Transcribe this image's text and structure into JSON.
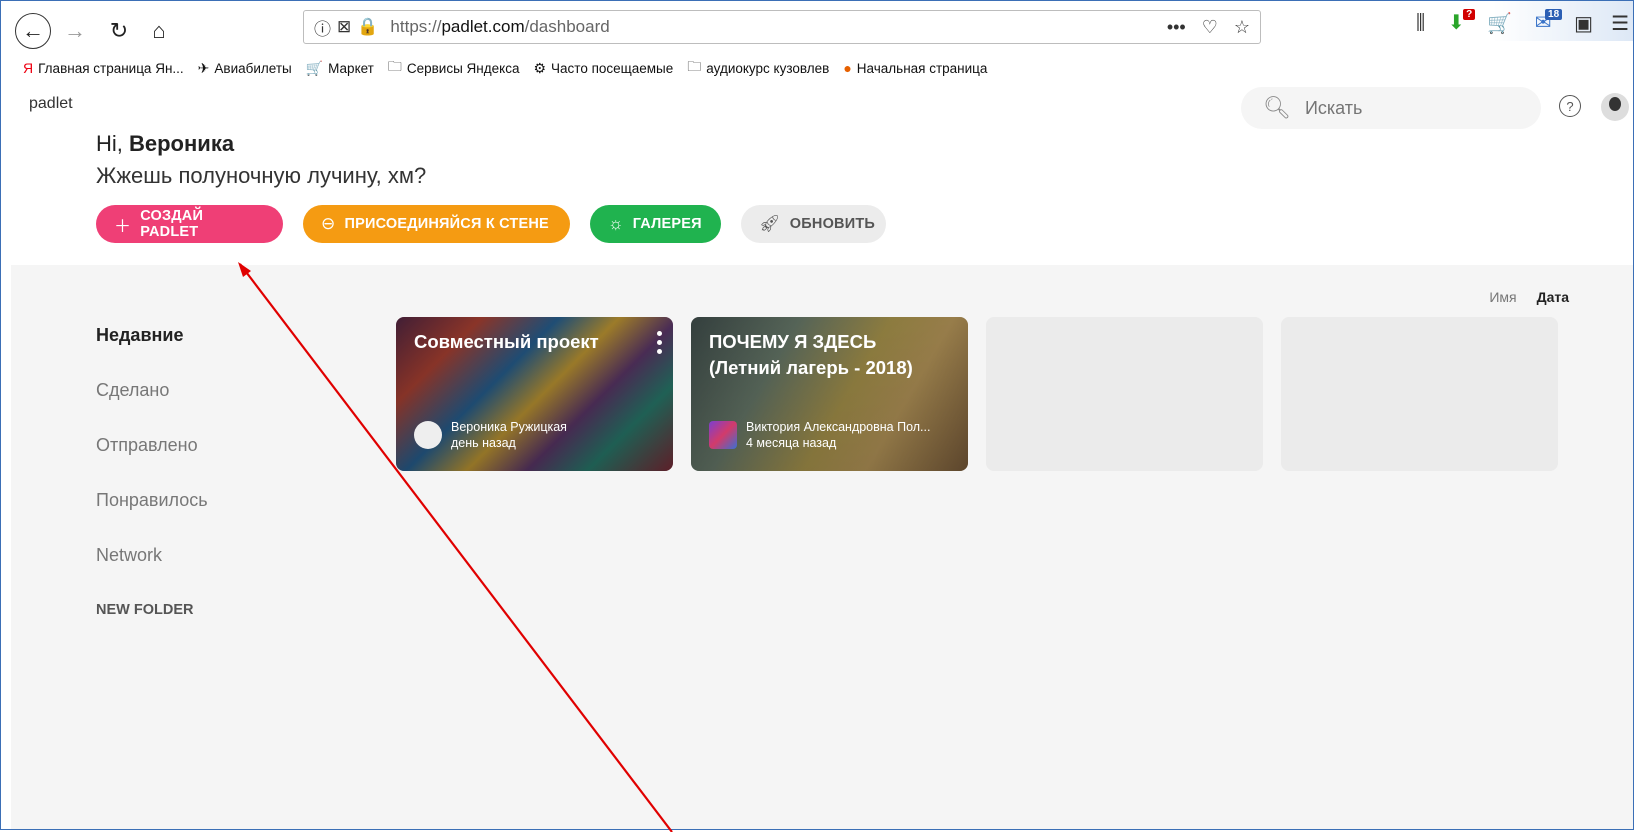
{
  "browser": {
    "url_prefix": "https://",
    "url_domain": "padlet.com",
    "url_path": "/dashboard",
    "more_label": "•••",
    "badge_red": "?",
    "badge_blue": "18"
  },
  "bookmarks": [
    {
      "label": "Главная страница Ян...",
      "icon": "yandex-icon"
    },
    {
      "label": "Авиабилеты",
      "icon": "plane-icon"
    },
    {
      "label": "Маркет",
      "icon": "cart-icon"
    },
    {
      "label": "Сервисы Яндекса",
      "icon": "folder-icon"
    },
    {
      "label": "Часто посещаемые",
      "icon": "gear-icon"
    },
    {
      "label": "аудиокурс кузовлев",
      "icon": "folder-icon"
    },
    {
      "label": "Начальная страница",
      "icon": "firefox-icon"
    }
  ],
  "app": {
    "logo": "padlet",
    "search_placeholder": "Искать",
    "greeting_prefix": "Hi, ",
    "user_name": "Вероника",
    "tagline": "Жжешь полуночную лучину, хм?"
  },
  "actions": {
    "create": "СОЗДАЙ PADLET",
    "join": "ПРИСОЕДИНЯЙСЯ К СТЕНЕ",
    "gallery": "ГАЛЕРЕЯ",
    "update": "ОБНОВИТЬ"
  },
  "sort": {
    "name": "Имя",
    "date": "Дата",
    "active": "Дата"
  },
  "nav": {
    "recent": "Недавние",
    "made": "Сделано",
    "sent": "Отправлено",
    "liked": "Понравилось",
    "network": "Network",
    "new_folder": "NEW FOLDER"
  },
  "cards": [
    {
      "title": "Совместный проект",
      "author": "Вероника Ружицкая",
      "time": "день назад"
    },
    {
      "title": "ПОЧЕМУ Я ЗДЕСЬ (Летний лагерь - 2018)",
      "author": "Виктория Александровна Пол...",
      "time": "4 месяца назад"
    }
  ],
  "colors": {
    "create": "#ef3f76",
    "join": "#f59b12",
    "gallery": "#20b34f",
    "update_bg": "#ececec",
    "annotation_arrow": "#e00000"
  }
}
